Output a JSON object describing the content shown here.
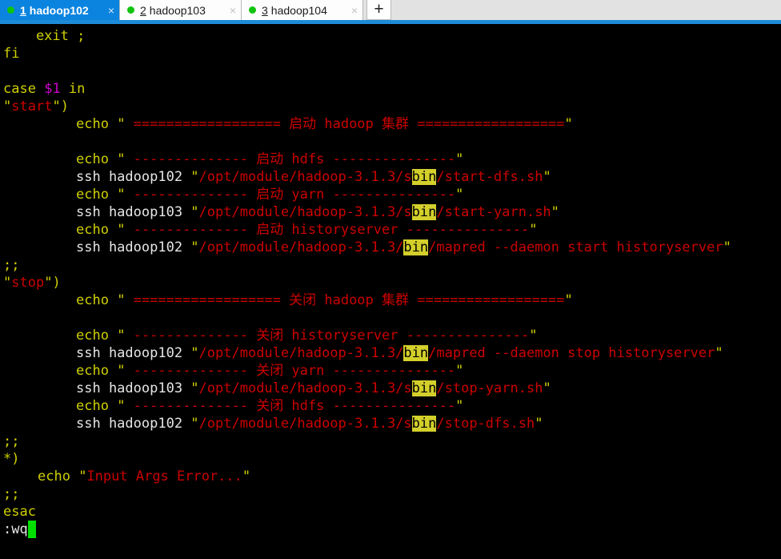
{
  "window": {
    "type": "terminal-emulator",
    "accent_color": "#1d8bd8",
    "tabbar_bg": "#e2e2e2"
  },
  "tabs": {
    "items": [
      {
        "index": "1",
        "title": "hadoop102",
        "active": true,
        "status_color": "#0ec40e",
        "close_label": "×"
      },
      {
        "index": "2",
        "title": "hadoop103",
        "active": false,
        "status_color": "#0ec40e",
        "close_label": "×"
      },
      {
        "index": "3",
        "title": "hadoop104",
        "active": false,
        "status_color": "#0ec40e",
        "close_label": "×"
      }
    ],
    "new_tab_label": "+"
  },
  "editor": {
    "mode_line": ":wq",
    "search_highlight": "bin",
    "highlight_bg": "#d3cf2b",
    "background": "#000000",
    "lines": {
      "l01": "    exit ;",
      "l02": "fi",
      "l03": "",
      "l04_case": "case ",
      "l04_var": "$1",
      "l04_in": " in",
      "l05_str": "start",
      "l05_tail": ")",
      "l06_echo": "echo ",
      "l06_body": " ================== 启动 hadoop 集群 ==================",
      "l07": "",
      "l08_body": " -------------- 启动 hdfs ---------------",
      "l09_cmd": "ssh hadoop102 ",
      "l09_p1": "/opt/module/hadoop-3.1.3/s",
      "l09_p2": "bin",
      "l09_p3": "/start-dfs.sh",
      "l10_body": " -------------- 启动 yarn ---------------",
      "l11_cmd": "ssh hadoop103 ",
      "l11_p1": "/opt/module/hadoop-3.1.3/s",
      "l11_p2": "bin",
      "l11_p3": "/start-yarn.sh",
      "l12_body": " -------------- 启动 historyserver ---------------",
      "l13_cmd": "ssh hadoop102 ",
      "l13_p1": "/opt/module/hadoop-3.1.3/",
      "l13_p2": "bin",
      "l13_p3": "/mapred --daemon start historyserver",
      "l14_semi": ";;",
      "l15_str": "stop",
      "l15_tail": ")",
      "l16_body": " ================== 关闭 hadoop 集群 ==================",
      "l17": "",
      "l18_body": " -------------- 关闭 historyserver ---------------",
      "l19_cmd": "ssh hadoop102 ",
      "l19_p1": "/opt/module/hadoop-3.1.3/",
      "l19_p2": "bin",
      "l19_p3": "/mapred --daemon stop historyserver",
      "l20_body": " -------------- 关闭 yarn ---------------",
      "l21_cmd": "ssh hadoop103 ",
      "l21_p1": "/opt/module/hadoop-3.1.3/s",
      "l21_p2": "bin",
      "l21_p3": "/stop-yarn.sh",
      "l22_body": " -------------- 关闭 hdfs ---------------",
      "l23_cmd": "ssh hadoop102 ",
      "l23_p1": "/opt/module/hadoop-3.1.3/s",
      "l23_p2": "bin",
      "l23_p3": "/stop-dfs.sh",
      "l24_semi": ";;",
      "l25_star": "*)",
      "l26_echo": "echo ",
      "l26_body": "Input Args Error...",
      "l27_semi": ";;",
      "l28_esac": "esac"
    },
    "quote": "\""
  }
}
